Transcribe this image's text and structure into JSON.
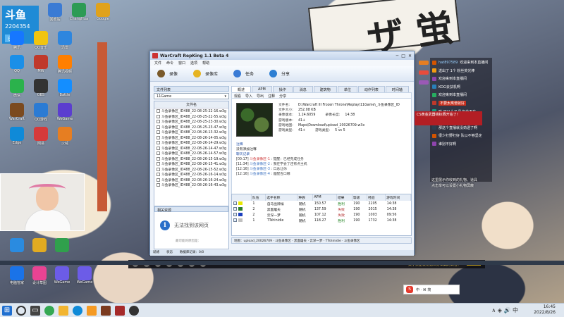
{
  "colors": {
    "accent": "#1f8bd6",
    "window_border": "#6c8db8",
    "win_green": "#1a7f1a",
    "lose_red": "#b02a2a",
    "alert_red": "#b31e24"
  },
  "id_tile": {
    "logo": "斗鱼",
    "number": "2204354",
    "follow": "已关注"
  },
  "desktop": {
    "icons": [
      {
        "name": "回收站",
        "color": "#3b7bd4"
      },
      {
        "name": "ChangHua",
        "color": "#2d9b55"
      },
      {
        "name": "Google",
        "color": "#e0a21b"
      },
      {
        "name": "腾讯",
        "color": "#1677ff"
      },
      {
        "name": "QQ",
        "color": "#1a8fe8"
      },
      {
        "name": "微信",
        "color": "#2bb24c"
      },
      {
        "name": "WarCraft",
        "color": "#7b4a1f"
      },
      {
        "name": "Edge",
        "color": "#0f8ad8"
      },
      {
        "name": "QQ音乐",
        "color": "#f1c40f"
      },
      {
        "name": "MW",
        "color": "#c0392b"
      },
      {
        "name": "OBS",
        "color": "#333333"
      },
      {
        "name": "QQ游戏",
        "color": "#2b7bd4"
      },
      {
        "name": "网易",
        "color": "#d63a3a"
      },
      {
        "name": "迅雷",
        "color": "#2e86de"
      },
      {
        "name": "腾讯视频",
        "color": "#ff7f00"
      },
      {
        "name": "Battle",
        "color": "#148eff"
      },
      {
        "name": "WeGame",
        "color": "#5b3ecf"
      },
      {
        "name": "火绒",
        "color": "#e67e22"
      }
    ],
    "bottom_icons": [
      {
        "name": "电脑管家",
        "color": "#1a73e8"
      },
      {
        "name": "设计草图",
        "color": "#e84393"
      },
      {
        "name": "WeGame",
        "color": "#6c5ce7"
      },
      {
        "name": "WeGame",
        "color": "#6c5ce7"
      }
    ]
  },
  "window": {
    "title": "WarCraft RepKing 1.1 Beta 4",
    "menu": [
      "文件",
      "命令",
      "窗口",
      "选项",
      "帮助"
    ],
    "toolbar": [
      "录像",
      "录像库",
      "任务",
      "分享"
    ],
    "left": {
      "list_title": "文件列表",
      "dir_value": "11Game",
      "list_header": "文件名",
      "files": [
        "斗鱼录像区_ID488_22-08-25-22-16.w3g",
        "斗鱼录像区_ID488_22-08-25-22-55.w3g",
        "斗鱼录像区_ID488_22-08-25-23-30.w3g",
        "斗鱼录像区_ID488_22-08-25-23-47.w3g",
        "斗鱼录像区_ID488_22-08-26-13-32.w3g",
        "斗鱼录像区_ID488_22-08-26-14-05.w3g",
        "斗鱼录像区_ID488_22-08-26-14-29.w3g",
        "斗鱼录像区_ID488_22-08-26-14-47.w3g",
        "斗鱼录像区_ID488_22-08-26-14-57.w3g",
        "斗鱼录像区_ID488_22-08-26-15-19.w3g",
        "斗鱼录像区_ID488_22-08-26-15-41.w3g",
        "斗鱼录像区_ID488_22-08-26-15-52.w3g",
        "斗鱼录像区_ID488_22-08-26-16-14.w3g",
        "斗鱼录像区_ID488_22-08-26-16-24.w3g",
        "斗鱼录像区_ID488_22-08-26-16-43.w3g"
      ],
      "related_title": "相关资源",
      "related_msg": "无法找到该网页",
      "related_sub": "最可能的原因是："
    },
    "tabs": [
      "概述",
      "APM",
      "操作",
      "消息",
      "建筑物",
      "单位",
      "动作列表",
      "时间轴"
    ],
    "subtools": [
      "观看",
      "导入",
      "导出",
      "注释",
      "分享"
    ],
    "details": [
      {
        "k": "文件名:",
        "v": "D:\\Warcraft III Frozen Throne\\Replay\\11Game\\_斗鱼录像区_ID"
      },
      {
        "k": "文件大小:",
        "v": "252.08 KB"
      },
      {
        "k": "录像版本:",
        "v": "1.24.6059",
        "k2": "录像长度:",
        "v2": "14:38"
      },
      {
        "k": "游戏版本:",
        "v": "41+"
      },
      {
        "k": "游戏地图:",
        "v": "Maps\\Download\\upload_20026709.w3x"
      },
      {
        "k": "游戏类型:",
        "v": "41+",
        "k2": "游戏类型:",
        "v2": "5 vs 5"
      }
    ],
    "notes_title": "注释",
    "notes_text": "没有添加注释",
    "chat_title": "聊天记录",
    "chat": [
      {
        "time": "[00:17]",
        "name": "斗鱼录像区-1",
        "msg": "提醒：已经完成任务"
      },
      {
        "time": "[11:34]",
        "name": "斗鱼录像区-2",
        "msg": "我在学会了还有点主机"
      },
      {
        "time": "[12:16]",
        "name": "斗鱼录像区-3",
        "msg": "口总让你"
      },
      {
        "time": "[12:16]",
        "name": "斗鱼录像区-4",
        "msg": "是配合口哪"
      }
    ],
    "players_headers": [
      "",
      "队伍",
      "选手名称",
      "种族",
      "APM",
      "结果",
      "等级",
      "经验",
      "游戏时间"
    ],
    "players": [
      {
        "team": "1",
        "name": "自马出牌候",
        "race": "随机",
        "apm": "150.57",
        "result": "胜利",
        "level": "190",
        "exp": "2205",
        "time": "14:38",
        "color": "#e8e800"
      },
      {
        "team": "2",
        "name": "黑面屠夫",
        "race": "随机",
        "apm": "137.59",
        "result": "失败",
        "level": "190",
        "exp": "2015",
        "time": "14:38",
        "color": "#2b7d2b"
      },
      {
        "team": "2",
        "name": "云深一梦",
        "race": "随机",
        "apm": "107.12",
        "result": "失败",
        "level": "190",
        "exp": "1003",
        "time": "09:56",
        "color": "#1b3fbf"
      },
      {
        "team": "1",
        "name": "TTshinidie",
        "race": "随机",
        "apm": "118.27",
        "result": "胜利",
        "level": "190",
        "exp": "1732",
        "time": "14:38",
        "color": "#c0c0c0"
      }
    ],
    "path_bar": "地图：upload_20026709 · 斗鱼录像区 · 黑面屠夫 · 云深一梦 · TTshinidie · 斗鱼录像区",
    "status": [
      "就绪",
      "状态",
      "数据库记录：0/0"
    ]
  },
  "chat_overlay": {
    "lines": [
      {
        "name": "hat897589",
        "msg": "欢迎来到本直播间",
        "badge": "#d35400"
      },
      {
        "name": "",
        "msg": "送出了 1个 粉丝荧光棒",
        "badge": "#f39c12"
      },
      {
        "name": "",
        "msg": "欢迎来到本直播间",
        "badge": "#8e44ad"
      },
      {
        "name": "",
        "msg": "KOG去扶机啊",
        "badge": "#2980b9"
      },
      {
        "name": "",
        "msg": "欢迎来到本直播间",
        "badge": "#27ae60"
      },
      {
        "name": "",
        "msg": "不要太离谱就好",
        "badge": "#c0392b"
      },
      {
        "name": "",
        "msg": "哈 可以人了 队友全不在",
        "badge": "#16a085"
      },
      {
        "name": "",
        "msg": "我还说都跟好啊",
        "badge": "#7f8c8d"
      },
      {
        "name": "",
        "msg": "那这个直播就没劲透了啊",
        "badge": "#2c3e50"
      },
      {
        "name": "",
        "msg": "很少打野打好 队以不够坚定",
        "badge": "#d35400"
      },
      {
        "name": "",
        "msg": "谁别不好啊",
        "badge": "#8e44ad"
      }
    ],
    "alert": "CS黄金武器锦标赛开始了！",
    "notice_lines": [
      "这里展示你收到的礼物、道具",
      "点击举可以设置小礼物屏蔽"
    ]
  },
  "stream_bar": {
    "notice": "关于禁止使用第三方工具的公告！"
  },
  "input_bar": {
    "label": "中 · ⌘ 简"
  },
  "taskbar": {
    "clock_time": "16:45",
    "clock_date": "2022/8/26",
    "tray": "∧ ◈ 🔊 中"
  }
}
